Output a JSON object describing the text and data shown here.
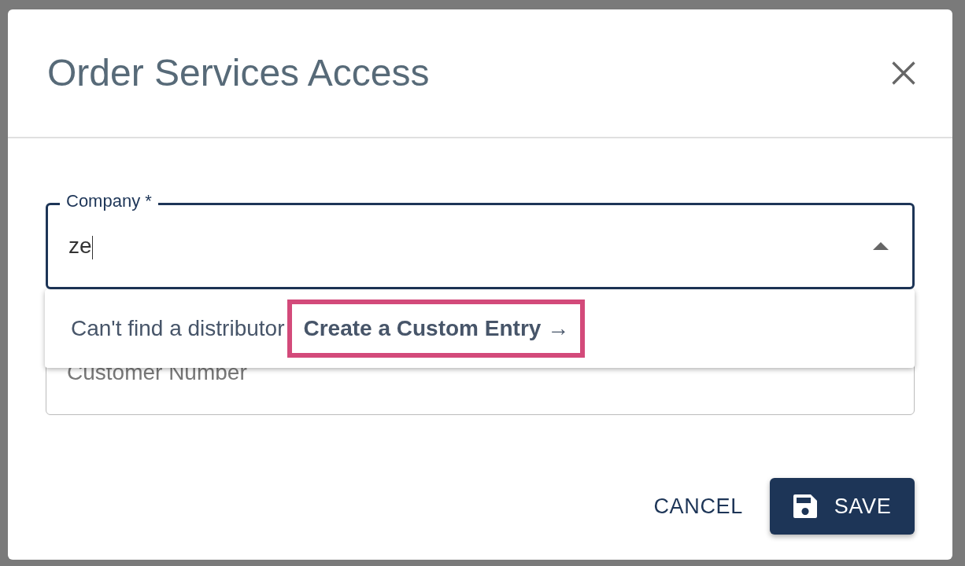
{
  "dialog": {
    "title": "Order Services Access"
  },
  "company_field": {
    "label": "Company *",
    "value": "ze",
    "focused": true,
    "expanded": true
  },
  "dropdown": {
    "prompt": "Can't find a distributor",
    "link": "Create a Custom Entry →",
    "highlighted": true
  },
  "customer_field": {
    "label": "Customer Number"
  },
  "buttons": [
    {
      "kind": "text",
      "label": "CANCEL"
    },
    {
      "kind": "save",
      "label": "SAVE"
    }
  ]
}
